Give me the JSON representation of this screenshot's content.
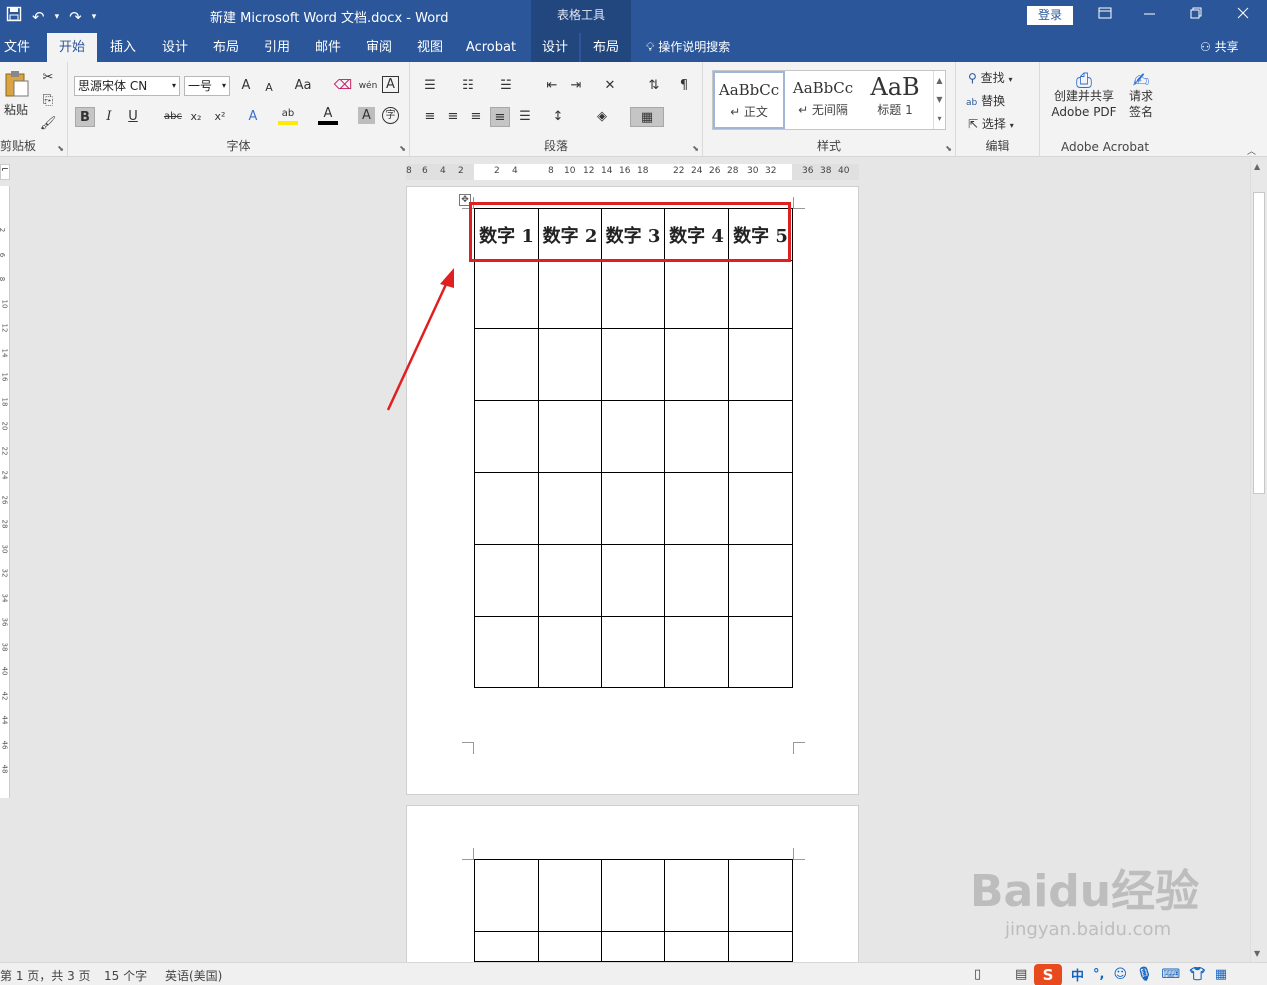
{
  "titlebar": {
    "doc_title": "新建 Microsoft Word 文档.docx  -  Word",
    "contextual_header": "表格工具",
    "login": "登录",
    "qat_icons": [
      "save-icon",
      "undo-icon",
      "redo-icon",
      "customize-qat-icon"
    ],
    "window_icons": [
      "ribbon-display-icon",
      "minimize-icon",
      "restore-icon",
      "close-icon"
    ]
  },
  "tabs": [
    "文件",
    "开始",
    "插入",
    "设计",
    "布局",
    "引用",
    "邮件",
    "审阅",
    "视图",
    "Acrobat",
    "设计",
    "布局"
  ],
  "active_tab": "开始",
  "tell_me": "操作说明搜索",
  "share": "共享",
  "ribbon": {
    "clipboard": {
      "label": "剪贴板",
      "paste": "粘贴"
    },
    "font": {
      "label": "字体",
      "font_name": "思源宋体 CN",
      "font_size": "一号",
      "grow": "A",
      "shrink": "A",
      "change_case": "Aa",
      "bold": "B",
      "italic": "I",
      "underline": "U",
      "strike": "abc",
      "subscript": "x₂",
      "superscript": "x²",
      "phonetic": "wén",
      "char_border": "A",
      "text_effects": "A",
      "highlight": "ab",
      "font_color": "A",
      "char_shading": "A",
      "enclose": "字"
    },
    "paragraph": {
      "label": "段落"
    },
    "styles": {
      "label": "样式",
      "items": [
        {
          "sample": "AaBbCc",
          "name": "↵ 正文"
        },
        {
          "sample": "AaBbCc",
          "name": "↵ 无间隔"
        },
        {
          "sample": "AaB",
          "name": "标题 1"
        }
      ]
    },
    "editing": {
      "label": "编辑",
      "find": "查找",
      "replace": "替换",
      "select": "选择"
    },
    "acrobat": {
      "label": "Adobe Acrobat",
      "create_pdf": "创建并共享\nAdobe PDF",
      "sign": "请求\n签名"
    }
  },
  "ruler": {
    "h_numbers": [
      "8",
      "6",
      "4",
      "2",
      "2",
      "4",
      "8",
      "10",
      "12",
      "14",
      "16",
      "18",
      "22",
      "24",
      "26",
      "28",
      "30",
      "32",
      "36",
      "38",
      "40"
    ],
    "v_numbers": [
      "2",
      "6",
      "8",
      "10",
      "12",
      "14",
      "16",
      "18",
      "20",
      "22",
      "24",
      "26",
      "28",
      "30",
      "32",
      "34",
      "36",
      "38",
      "40",
      "42",
      "44",
      "46",
      "48"
    ]
  },
  "table": {
    "headers": [
      "数字 1",
      "数字 2",
      "数字 3",
      "数字 4",
      "数字 5"
    ]
  },
  "statusbar": {
    "page": "第 1 页，共 3 页",
    "words": "15 个字",
    "language": "英语(美国)",
    "ime": {
      "logo": "S",
      "mode": "中",
      "punct": "°,"
    }
  },
  "watermark": {
    "brand": "Baidu经验",
    "url": "jingyan.baidu.com"
  },
  "colors": {
    "brand": "#2b579a",
    "highlight_box": "#e02020"
  }
}
